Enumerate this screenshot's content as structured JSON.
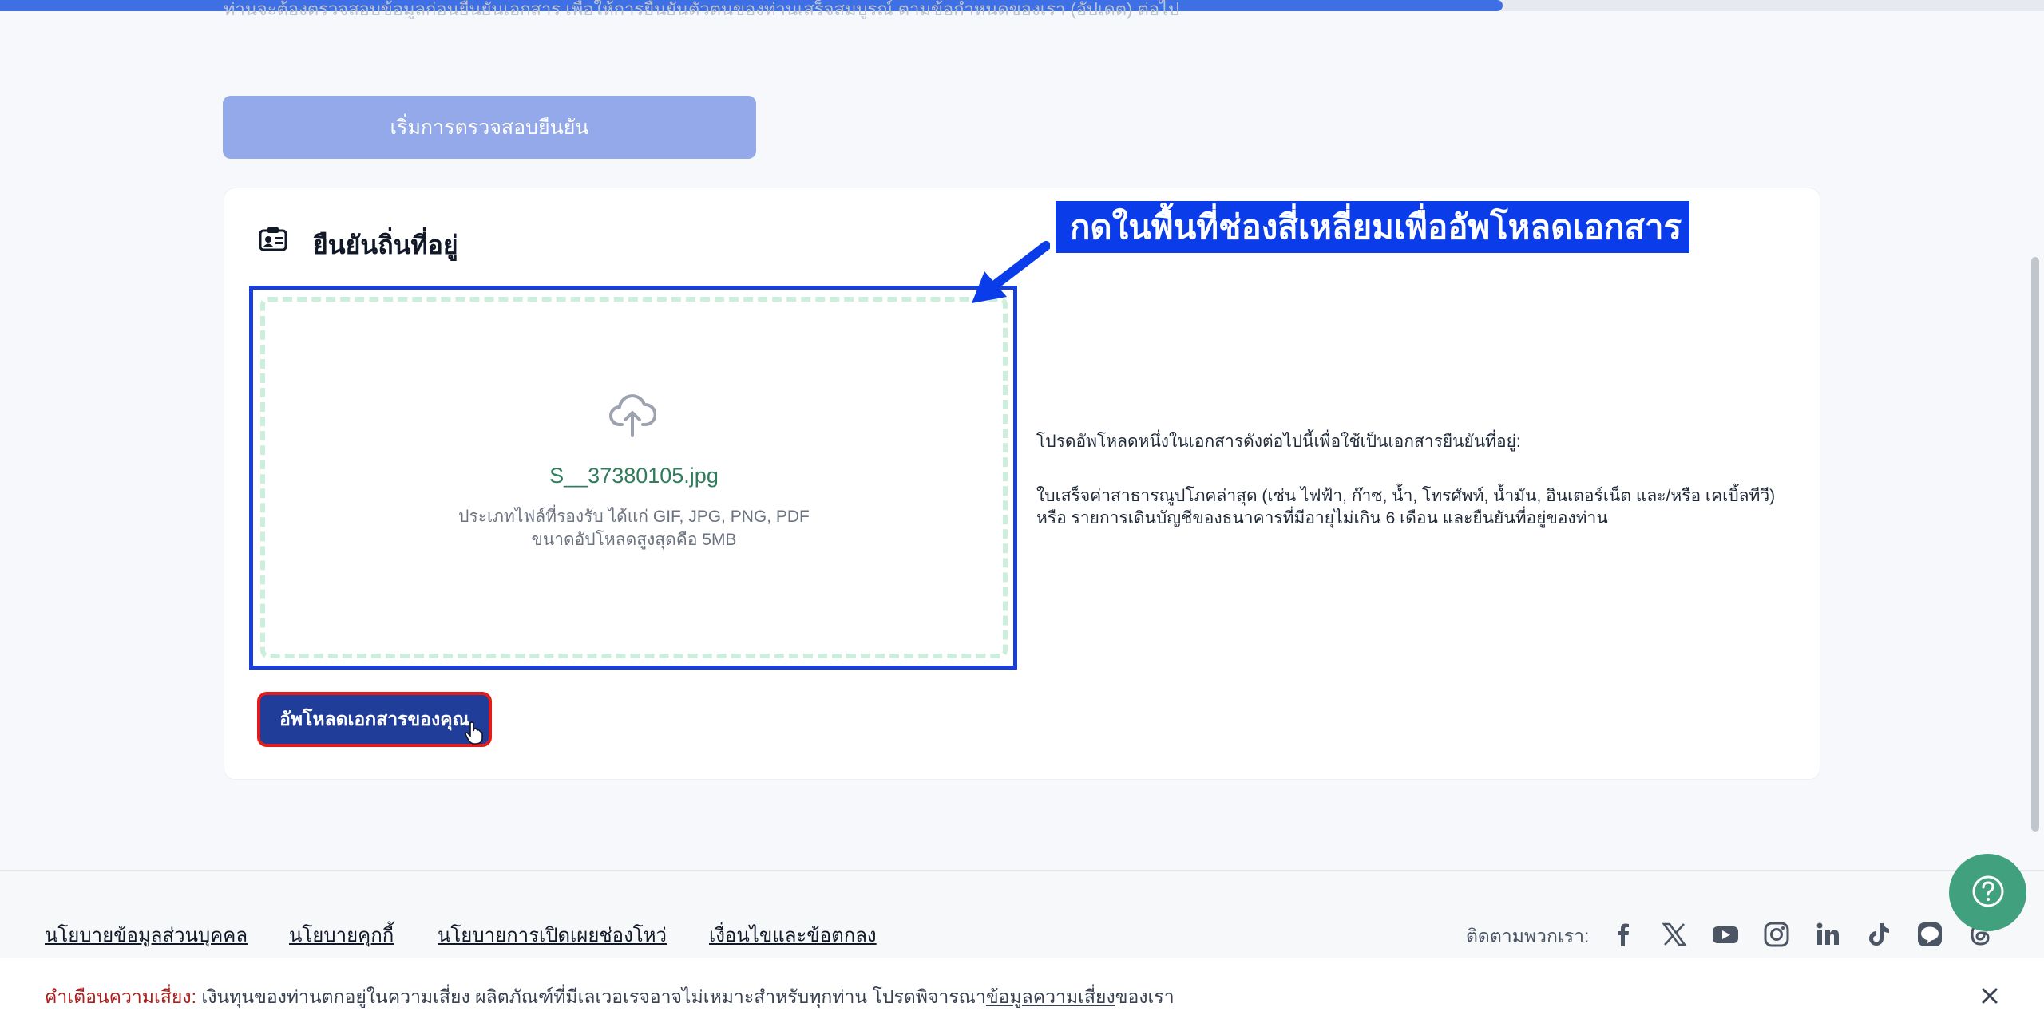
{
  "page": {
    "progress_percent": 75,
    "top_cut_text": "ท่านจะต้องตรวจสอบข้อมูลก่อนยืนยันเอกสาร เพื่อให้การยืนยันตัวตนของท่านเสร็จสมบูรณ์ ตามข้อกำหนดของเรา (อัปเดต) ต่อไป"
  },
  "start_button": {
    "label": "เริ่มการตรวจสอบยืนยัน"
  },
  "card": {
    "title": "ยืนยันถิ่นที่อยู่",
    "icon": "id-card-icon",
    "drop_zone": {
      "icon": "cloud-upload-icon",
      "file_name": "S__37380105.jpg",
      "file_types": "ประเภทไฟล์ที่รองรับ ได้แก่ GIF, JPG, PNG, PDF",
      "file_size": "ขนาดอัปโหลดสูงสุดคือ 5MB"
    },
    "instructions": {
      "line1": "โปรดอัพโหลดหนึ่งในเอกสารดังต่อไปนี้เพื่อใช้เป็นเอกสารยืนยันที่อยู่:",
      "line2": "ใบเสร็จค่าสาธารณูปโภคล่าสุด (เช่น ไฟฟ้า, ก๊าซ, น้ำ, โทรศัพท์, น้ำมัน, อินเตอร์เน็ต และ/หรือ เคเบิ้ลทีวี) หรือ รายการเดินบัญชีของธนาคารที่มีอายุไม่เกิน 6 เดือน และยืนยันที่อยู่ของท่าน"
    },
    "upload_button": {
      "label": "อัพโหลดเอกสารของคุณ"
    }
  },
  "annotation": {
    "callout": "กดในพื้นที่ช่องสี่เหลี่ยมเพื่ออัพโหลดเอกสาร",
    "color": "#0a3cea"
  },
  "footer": {
    "links": [
      "นโยบายข้อมูลส่วนบุคคล",
      "นโยบายคุกกี้",
      "นโยบายการเปิดเผยช่องโหว่",
      "เงื่อนไขและข้อตกลง"
    ],
    "follow_label": "ติดตามพวกเรา:",
    "social_icons": [
      "facebook-icon",
      "x-icon",
      "youtube-icon",
      "instagram-icon",
      "linkedin-icon",
      "tiktok-icon",
      "line-icon",
      "threads-icon"
    ]
  },
  "help_button": {
    "icon": "question-icon",
    "color": "#41a07d"
  },
  "risk_banner": {
    "label": "คำเตือนความเสี่ยง:",
    "text": " เงินทุนของท่านตกอยู่ในความเสี่ยง ผลิตภัณฑ์ที่มีเลเวอเรจอาจไม่เหมาะสำหรับทุกท่าน โปรดพิจารณา",
    "link": "ข้อมูลความเสี่ยง",
    "suffix": "ของเรา"
  },
  "colors": {
    "accent": "#3e6fe4",
    "primary_button": "#1f3d99",
    "warning": "#b01d1d"
  }
}
